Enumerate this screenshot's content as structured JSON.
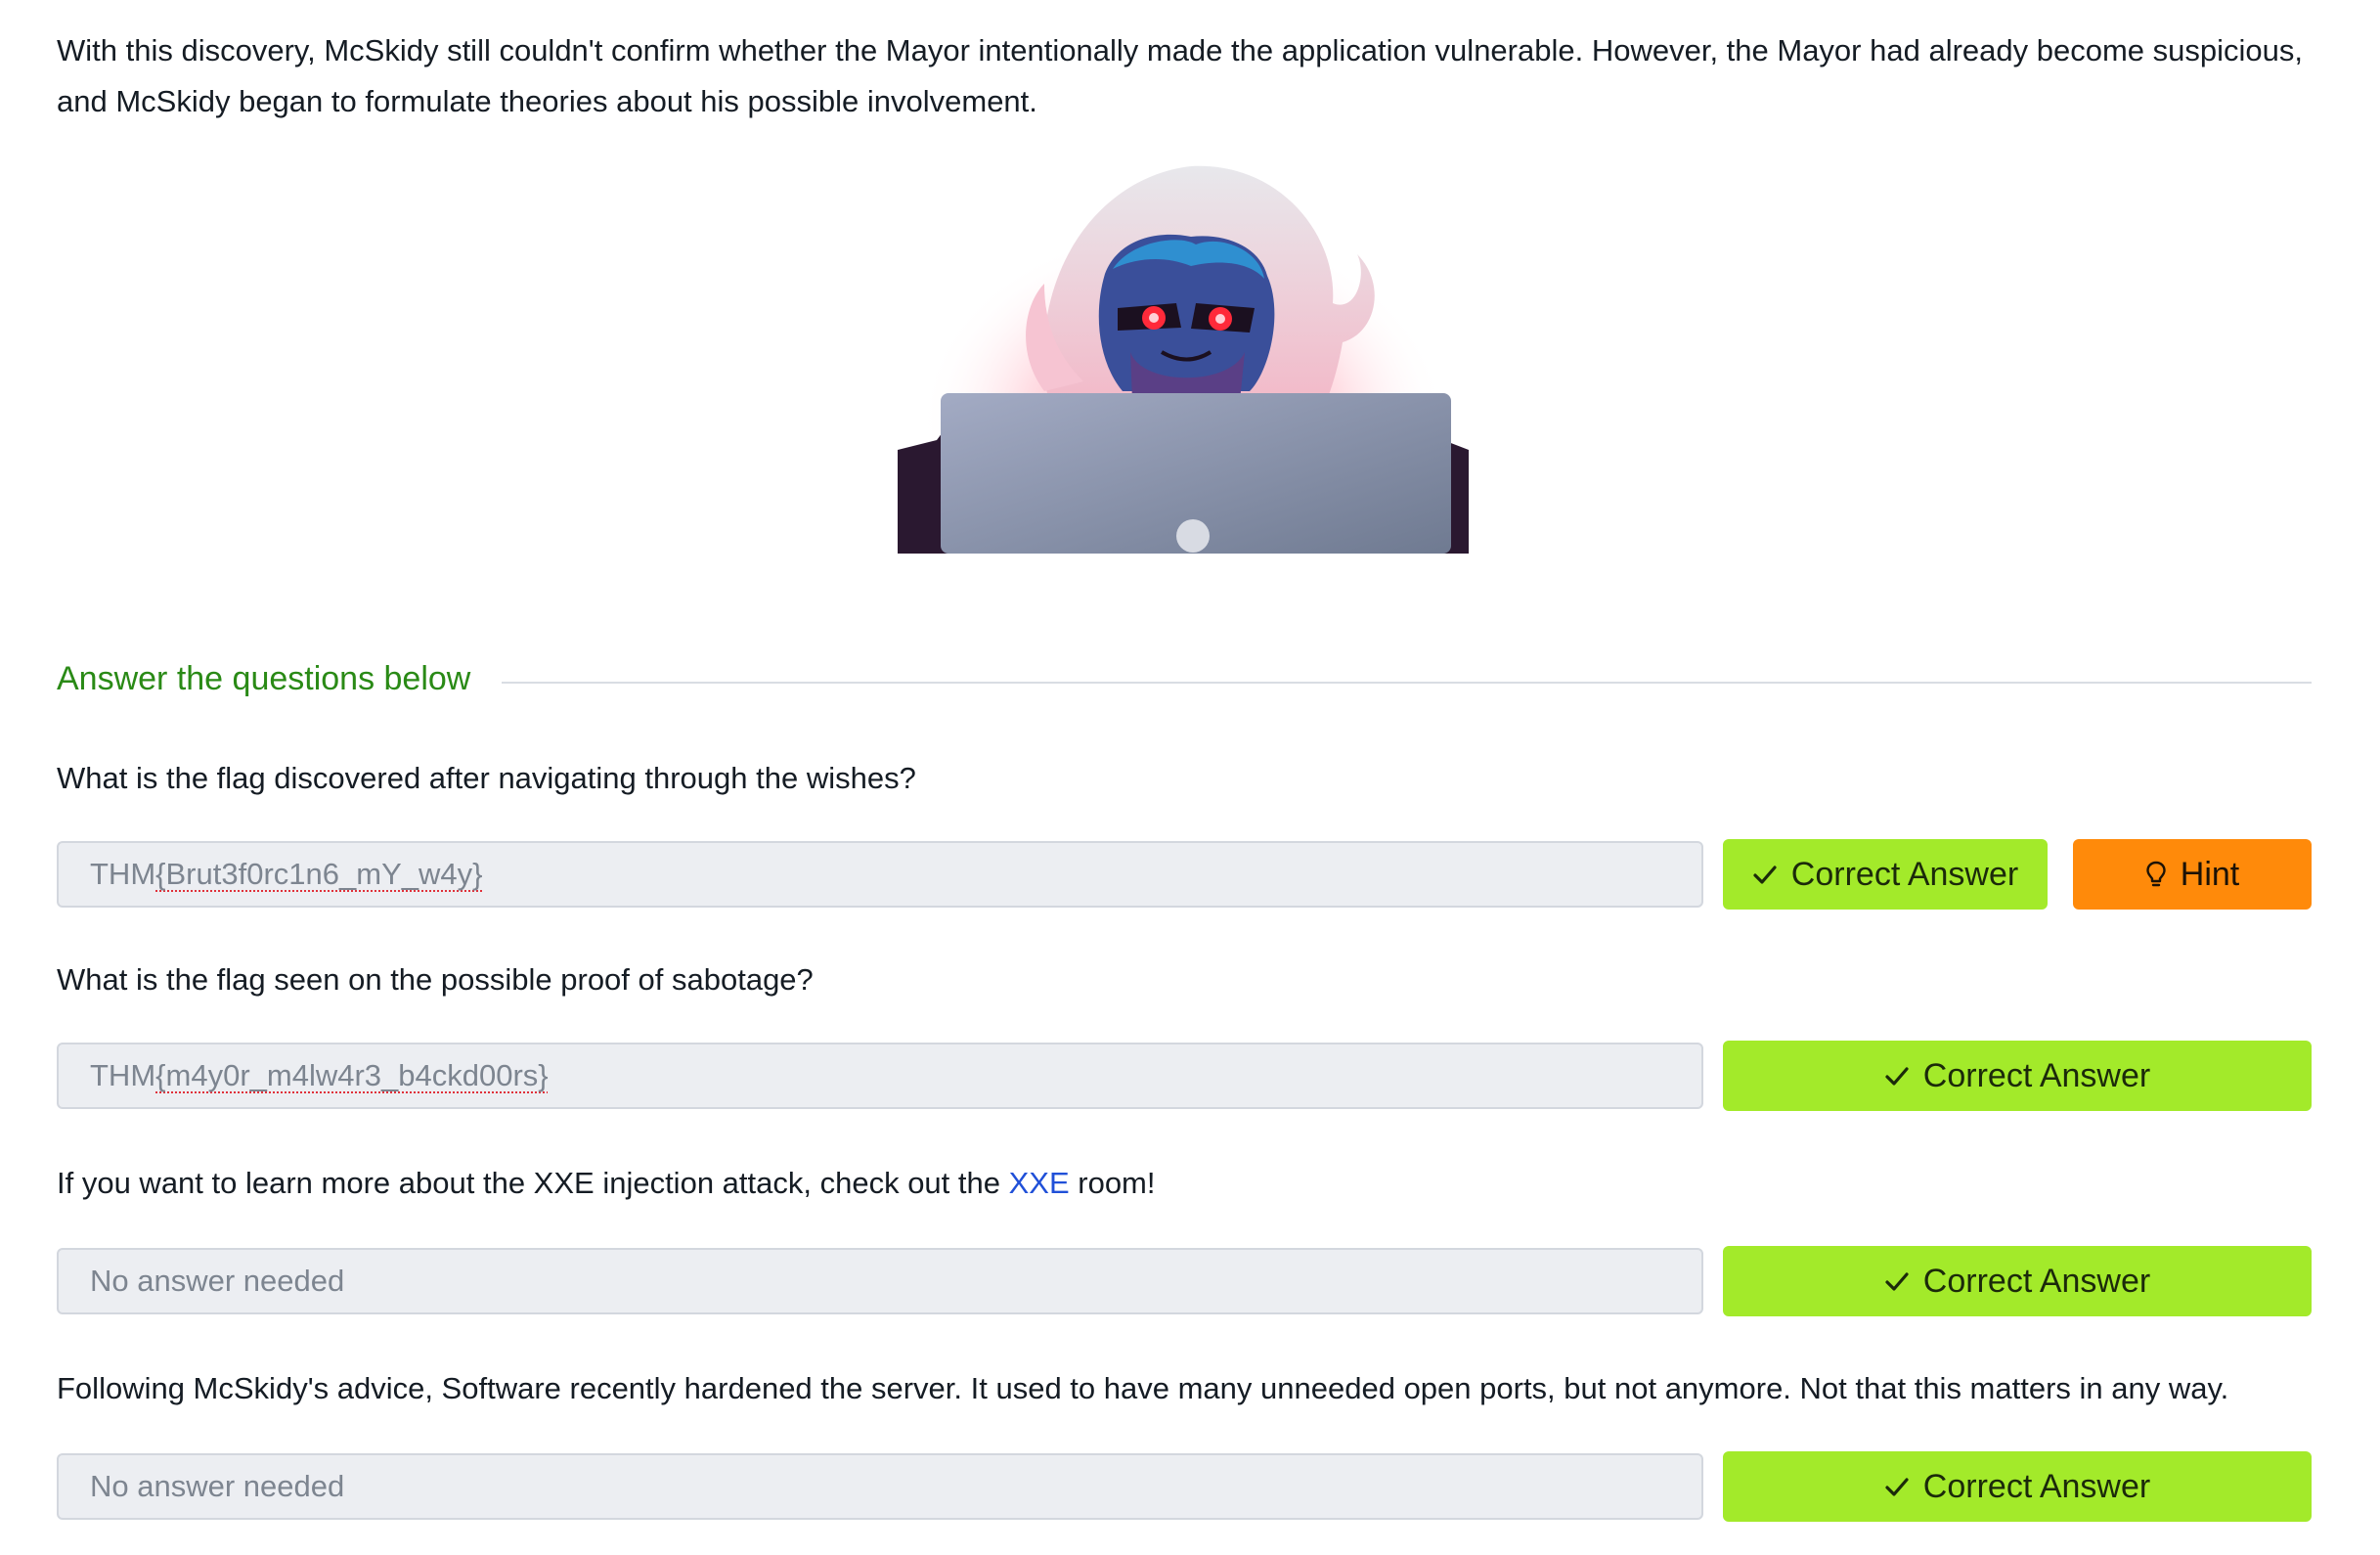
{
  "intro": {
    "text": "With this discovery, McSkidy still couldn't confirm whether the Mayor intentionally made the application vulnerable. However, the Mayor had already become suspicious, and McSkidy began to formulate theories about his possible involvement."
  },
  "section": {
    "title": "Answer the questions below"
  },
  "questions": [
    {
      "text": "What is the flag discovered after navigating through the wishes?",
      "answer_prefix": "THM",
      "answer_rest": "{Brut3f0rc1n6_mY_w4y}",
      "correct_label": "Correct Answer",
      "hint_label": "Hint"
    },
    {
      "text": "What is the flag seen on the possible proof of sabotage?",
      "answer_prefix": "THM",
      "answer_rest": "{m4y0r_m4lw4r3_b4ckd00rs}",
      "correct_label": "Correct Answer"
    },
    {
      "text_before": "If you want to learn more about the XXE injection attack, check out the ",
      "link_text": "XXE",
      "text_after": " room!",
      "answer_placeholder": "No answer needed",
      "correct_label": "Correct Answer"
    },
    {
      "text": "Following McSkidy's advice, Software recently hardened the server. It used to have many unneeded open ports, but not anymore. Not that this matters in any way.",
      "answer_placeholder": "No answer needed",
      "correct_label": "Correct Answer"
    }
  ],
  "colors": {
    "accent_green": "#2a8a16",
    "correct_button": "#a3ea2a",
    "hint_button": "#ff8a0a",
    "link": "#2050d8"
  }
}
